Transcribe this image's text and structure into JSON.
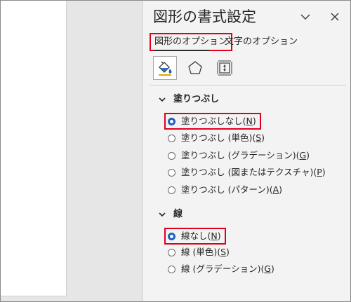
{
  "pane": {
    "title": "図形の書式設定",
    "tabs": {
      "shape_options": "図形のオプション",
      "text_options": "文字のオプション"
    }
  },
  "fill": {
    "header": "塗りつぶし",
    "options": [
      {
        "pre": "塗りつぶしなし(",
        "key": "N",
        "post": ")"
      },
      {
        "pre": "塗りつぶし (単色)(",
        "key": "S",
        "post": ")"
      },
      {
        "pre": "塗りつぶし (グラデーション)(",
        "key": "G",
        "post": ")"
      },
      {
        "pre": "塗りつぶし (図またはテクスチャ)(",
        "key": "P",
        "post": ")"
      },
      {
        "pre": "塗りつぶし (パターン)(",
        "key": "A",
        "post": ")"
      }
    ]
  },
  "line": {
    "header": "線",
    "options": [
      {
        "pre": "線なし(",
        "key": "N",
        "post": ")"
      },
      {
        "pre": "線 (単色)(",
        "key": "S",
        "post": ")"
      },
      {
        "pre": "線 (グラデーション)(",
        "key": "G",
        "post": ")"
      }
    ]
  },
  "colors": {
    "highlight": "#e0001b",
    "radio_selected": "#1f5fbf"
  },
  "icons": {
    "collapse": "chevron-down-icon",
    "close": "close-icon",
    "fill_line": "paint-bucket-icon",
    "effects": "pentagon-icon",
    "size": "size-properties-icon"
  }
}
